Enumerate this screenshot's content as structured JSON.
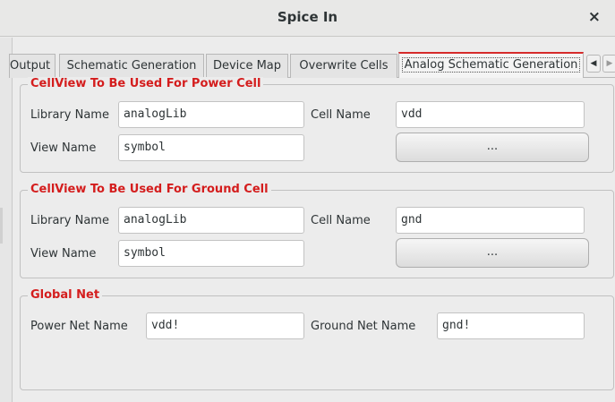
{
  "window": {
    "title": "Spice In",
    "close_glyph": "×"
  },
  "tabs": [
    {
      "label": "Output"
    },
    {
      "label": "Schematic Generation"
    },
    {
      "label": "Device Map"
    },
    {
      "label": "Overwrite Cells"
    },
    {
      "label": "Analog Schematic Generation",
      "active": true
    }
  ],
  "tab_scroll": {
    "left_glyph": "◀",
    "right_glyph": "▶"
  },
  "power_cell": {
    "legend": "CellView To Be Used For Power Cell",
    "library_label": "Library Name",
    "library_value": "analogLib",
    "cell_label": "Cell Name",
    "cell_value": "vdd",
    "view_label": "View Name",
    "view_value": "symbol",
    "browse_label": "..."
  },
  "ground_cell": {
    "legend": "CellView To Be Used For Ground Cell",
    "library_label": "Library Name",
    "library_value": "analogLib",
    "cell_label": "Cell Name",
    "cell_value": "gnd",
    "view_label": "View Name",
    "view_value": "symbol",
    "browse_label": "..."
  },
  "global_net": {
    "legend": "Global Net",
    "power_label": "Power Net Name",
    "power_value": "vdd!",
    "ground_label": "Ground Net Name",
    "ground_value": "gnd!"
  },
  "colors": {
    "legend": "#d41d1d",
    "active_tab_accent": "#d62b2b",
    "background": "#ececec"
  }
}
